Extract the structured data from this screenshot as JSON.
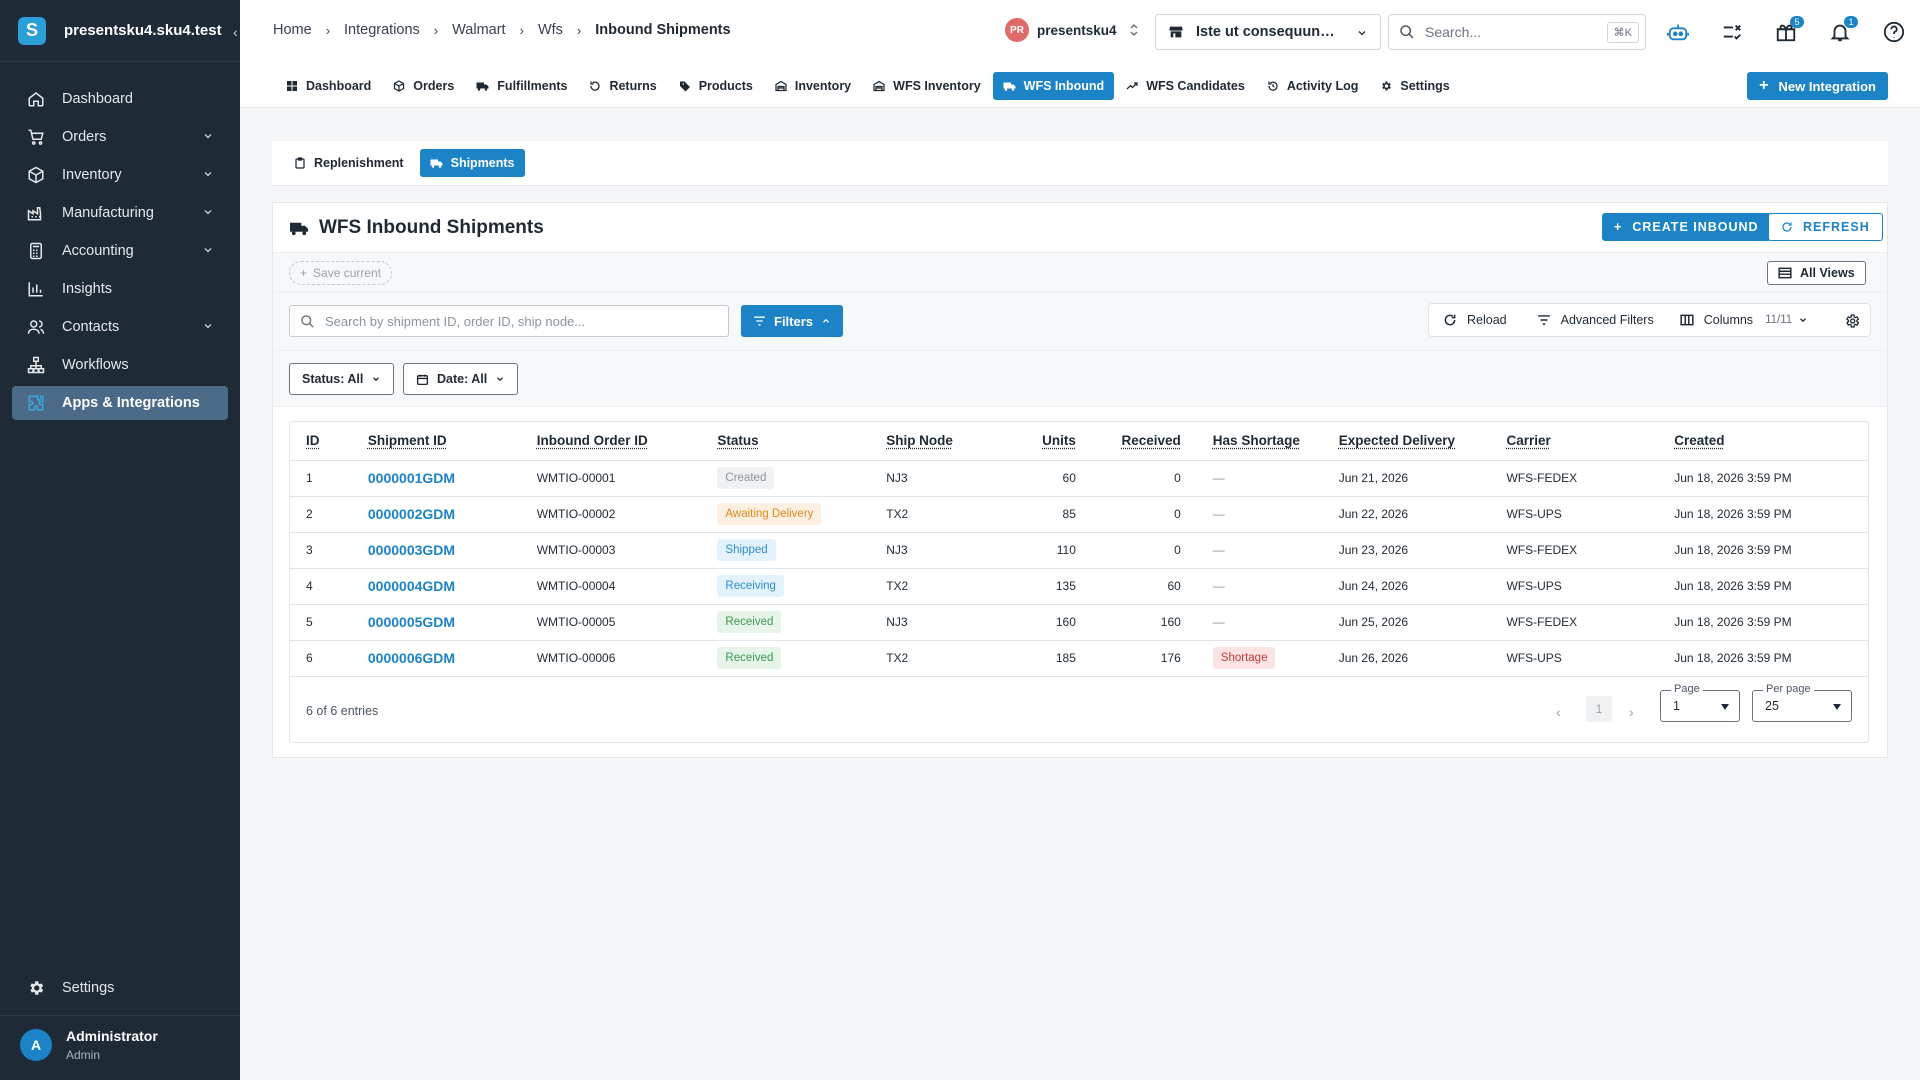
{
  "app": {
    "name": "presentsku4.sku4.test",
    "logo_letter": "S"
  },
  "sidebar": {
    "items": [
      {
        "label": "Dashboard",
        "icon": "home-icon",
        "has_children": false
      },
      {
        "label": "Orders",
        "icon": "cart-icon",
        "has_children": true
      },
      {
        "label": "Inventory",
        "icon": "box-icon",
        "has_children": true
      },
      {
        "label": "Manufacturing",
        "icon": "factory-icon",
        "has_children": true
      },
      {
        "label": "Accounting",
        "icon": "calculator-icon",
        "has_children": true
      },
      {
        "label": "Insights",
        "icon": "chart-icon",
        "has_children": false
      },
      {
        "label": "Contacts",
        "icon": "contacts-icon",
        "has_children": true
      },
      {
        "label": "Workflows",
        "icon": "workflow-icon",
        "has_children": false
      },
      {
        "label": "Apps & Integrations",
        "icon": "puzzle-icon",
        "has_children": false,
        "active": true
      }
    ],
    "settings_label": "Settings",
    "user": {
      "initial": "A",
      "name": "Administrator",
      "role": "Admin"
    }
  },
  "breadcrumb": [
    "Home",
    "Integrations",
    "Walmart",
    "Wfs",
    "Inbound Shipments"
  ],
  "org": {
    "badge": "PR",
    "name": "presentsku4"
  },
  "store_select": {
    "value": "Iste ut consequun…"
  },
  "search": {
    "placeholder": "Search...",
    "shortcut": "⌘K"
  },
  "badges": {
    "gifts": "5",
    "notifications": "1"
  },
  "tabs": [
    {
      "label": "Dashboard",
      "icon": "grid-icon"
    },
    {
      "label": "Orders",
      "icon": "box-icon"
    },
    {
      "label": "Fulfillments",
      "icon": "truck-icon"
    },
    {
      "label": "Returns",
      "icon": "return-icon"
    },
    {
      "label": "Products",
      "icon": "tag-icon"
    },
    {
      "label": "Inventory",
      "icon": "warehouse-icon"
    },
    {
      "label": "WFS Inventory",
      "icon": "warehouse-icon"
    },
    {
      "label": "WFS Inbound",
      "icon": "truck-icon",
      "active": true
    },
    {
      "label": "WFS Candidates",
      "icon": "trend-icon"
    },
    {
      "label": "Activity Log",
      "icon": "history-icon"
    },
    {
      "label": "Settings",
      "icon": "gear-icon"
    }
  ],
  "new_integration_label": "New Integration",
  "subtabs": [
    {
      "label": "Replenishment",
      "icon": "clipboard-icon"
    },
    {
      "label": "Shipments",
      "icon": "truck-icon",
      "active": true
    }
  ],
  "card": {
    "title": "WFS Inbound Shipments",
    "create_label": "CREATE INBOUND",
    "refresh_label": "REFRESH",
    "save_current_label": "Save current",
    "all_views_label": "All Views",
    "search_placeholder": "Search by shipment ID, order ID, ship node...",
    "filters_label": "Filters",
    "reload_label": "Reload",
    "advanced_filters_label": "Advanced Filters",
    "columns_label": "Columns",
    "columns_count": "11/11",
    "status_filter": "Status: All",
    "date_filter": "Date: All"
  },
  "table": {
    "columns": [
      "ID",
      "Shipment ID",
      "Inbound Order ID",
      "Status",
      "Ship Node",
      "Units",
      "Received",
      "Has Shortage",
      "Expected Delivery",
      "Carrier",
      "Created"
    ],
    "rows": [
      {
        "id": "1",
        "shipment_id": "0000001GDM",
        "order_id": "WMTIO-00001",
        "status": "Created",
        "status_class": "s-created",
        "ship_node": "NJ3",
        "units": "60",
        "received": "0",
        "shortage": "—",
        "expected": "Jun 21, 2026",
        "carrier": "WFS-FEDEX",
        "created": "Jun 18, 2026 3:59 PM"
      },
      {
        "id": "2",
        "shipment_id": "0000002GDM",
        "order_id": "WMTIO-00002",
        "status": "Awaiting Delivery",
        "status_class": "s-awaiting",
        "ship_node": "TX2",
        "units": "85",
        "received": "0",
        "shortage": "—",
        "expected": "Jun 22, 2026",
        "carrier": "WFS-UPS",
        "created": "Jun 18, 2026 3:59 PM"
      },
      {
        "id": "3",
        "shipment_id": "0000003GDM",
        "order_id": "WMTIO-00003",
        "status": "Shipped",
        "status_class": "s-shipped",
        "ship_node": "NJ3",
        "units": "110",
        "received": "0",
        "shortage": "—",
        "expected": "Jun 23, 2026",
        "carrier": "WFS-FEDEX",
        "created": "Jun 18, 2026 3:59 PM"
      },
      {
        "id": "4",
        "shipment_id": "0000004GDM",
        "order_id": "WMTIO-00004",
        "status": "Receiving",
        "status_class": "s-receiving",
        "ship_node": "TX2",
        "units": "135",
        "received": "60",
        "shortage": "—",
        "expected": "Jun 24, 2026",
        "carrier": "WFS-UPS",
        "created": "Jun 18, 2026 3:59 PM"
      },
      {
        "id": "5",
        "shipment_id": "0000005GDM",
        "order_id": "WMTIO-00005",
        "status": "Received",
        "status_class": "s-received",
        "ship_node": "NJ3",
        "units": "160",
        "received": "160",
        "shortage": "—",
        "expected": "Jun 25, 2026",
        "carrier": "WFS-FEDEX",
        "created": "Jun 18, 2026 3:59 PM"
      },
      {
        "id": "6",
        "shipment_id": "0000006GDM",
        "order_id": "WMTIO-00006",
        "status": "Received",
        "status_class": "s-received",
        "ship_node": "TX2",
        "units": "185",
        "received": "176",
        "shortage": "Shortage",
        "expected": "Jun 26, 2026",
        "carrier": "WFS-UPS",
        "created": "Jun 18, 2026 3:59 PM"
      }
    ]
  },
  "pagination": {
    "entries": "6 of 6 entries",
    "current": "1",
    "page_label": "Page",
    "page_value": "1",
    "per_page_label": "Per page",
    "per_page_value": "25"
  },
  "colors": {
    "sidebar": "#1f2a37",
    "accent": "#1c83c6",
    "active_nav": "#4a6a88"
  }
}
